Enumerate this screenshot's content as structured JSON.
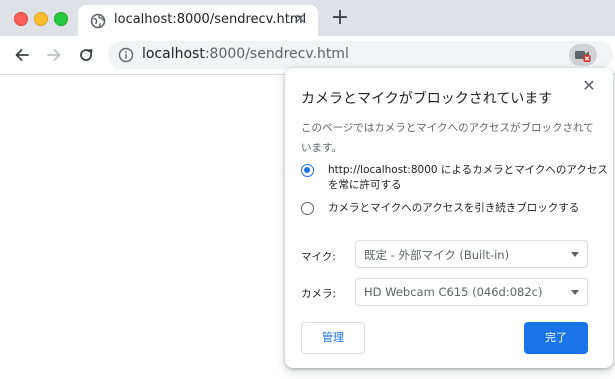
{
  "tab": {
    "title": "localhost:8000/sendrecv.html",
    "icon": "globe-icon",
    "close": "✕"
  },
  "new_tab": "+",
  "omnibox": {
    "url_host": "localhost",
    "url_rest": ":8000/sendrecv.html",
    "info_icon": "info-icon",
    "indicator_icon": "camera-blocked-icon"
  },
  "popup": {
    "title": "カメラとマイクがブロックされています",
    "close": "✕",
    "description": "このページではカメラとマイクへのアクセスがブロックされています。",
    "options": [
      {
        "label": "http://localhost:8000 によるカメラとマイクへのアクセスを常に許可する",
        "checked": true
      },
      {
        "label": "カメラとマイクへのアクセスを引き続きブロックする",
        "checked": false
      }
    ],
    "mic_label": "マイク:",
    "mic_value": "既定 - 外部マイク (Built-in)",
    "camera_label": "カメラ:",
    "camera_value": "HD Webcam C615 (046d:082c)",
    "manage_label": "管理",
    "done_label": "完了"
  },
  "colors": {
    "accent": "#1a73e8",
    "tabstrip": "#dee1e6",
    "omnibox": "#f1f3f4"
  }
}
